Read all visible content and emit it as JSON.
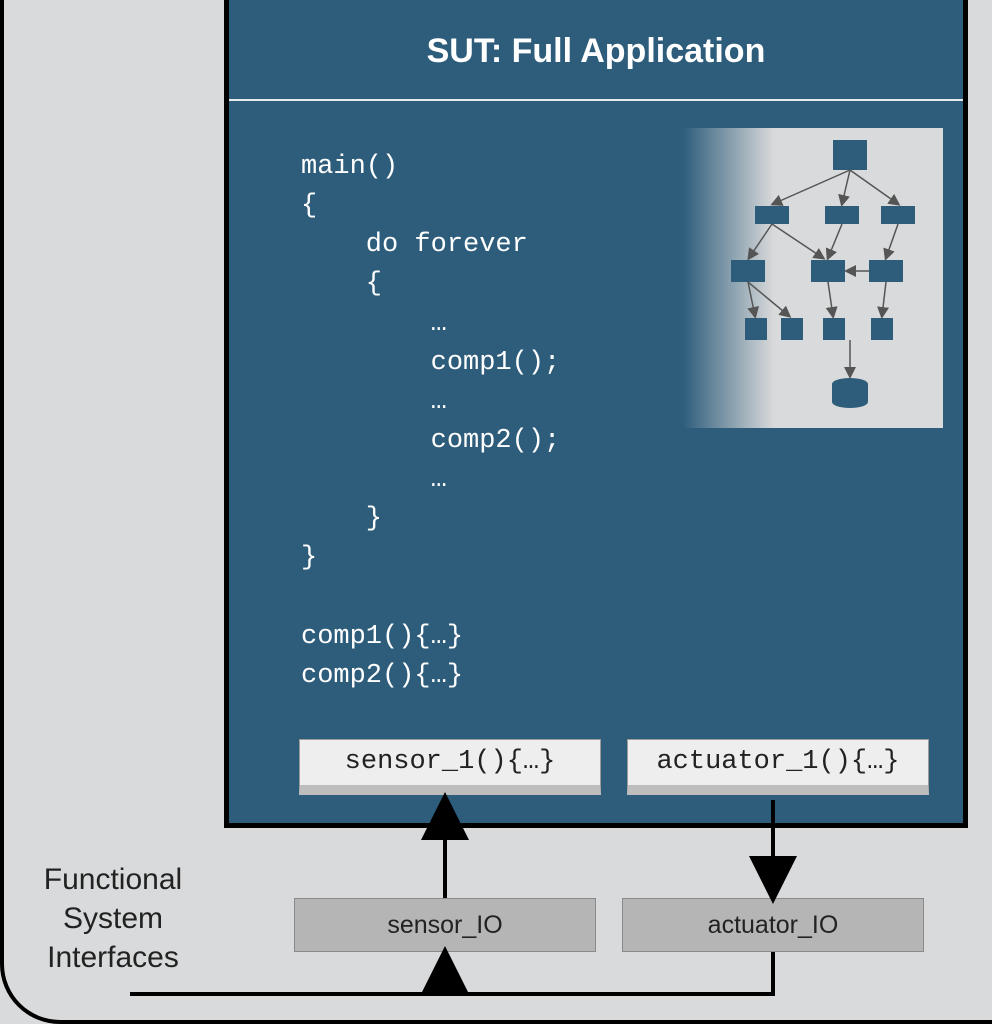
{
  "title": "SUT: Full Application",
  "code": "main()\n{\n    do forever\n    {\n        …\n        comp1();\n        …\n        comp2();\n        …\n    }\n}\n\ncomp1(){…}\ncomp2(){…}",
  "io": {
    "sensor_func": "sensor_1(){…}",
    "actuator_func": "actuator_1(){…}"
  },
  "external": {
    "sensor": "sensor_IO",
    "actuator": "actuator_IO"
  },
  "side_label": {
    "l1": "Functional",
    "l2": "System",
    "l3": "Interfaces"
  },
  "colors": {
    "sut_bg": "#2e5d7c",
    "page_bg": "#d9dadb",
    "node": "#2e5d7c"
  }
}
